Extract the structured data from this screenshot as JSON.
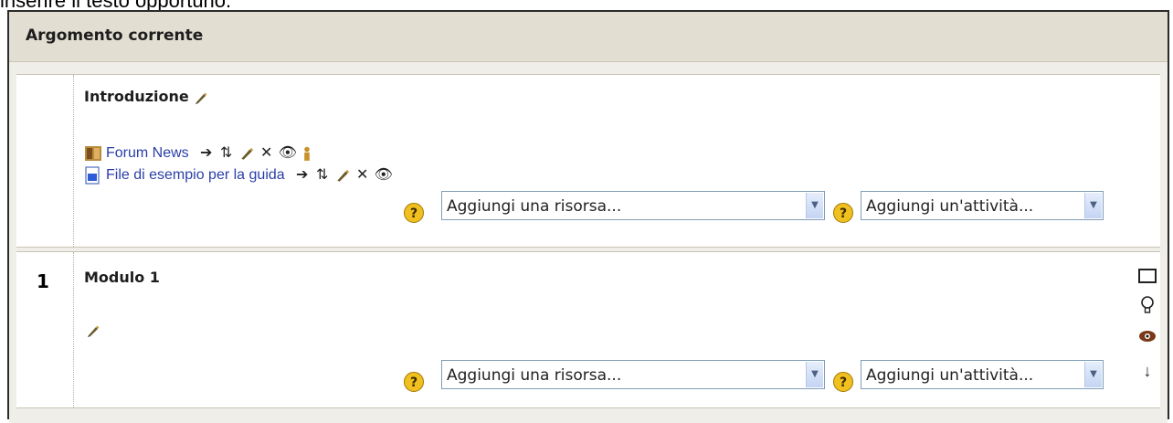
{
  "caption": "inserire il testo opportuno.",
  "header": {
    "title": "Argomento corrente"
  },
  "sections": [
    {
      "number": "",
      "title": "Introduzione",
      "resources": [
        {
          "label": "Forum News",
          "icon": "forum-icon"
        },
        {
          "label": "File di esempio per la guida",
          "icon": "document-icon"
        }
      ],
      "add_resource": "Aggiungi una risorsa...",
      "add_activity": "Aggiungi un'attività..."
    },
    {
      "number": "1",
      "title": "Modulo 1",
      "add_resource": "Aggiungi una risorsa...",
      "add_activity": "Aggiungi un'attività..."
    }
  ]
}
